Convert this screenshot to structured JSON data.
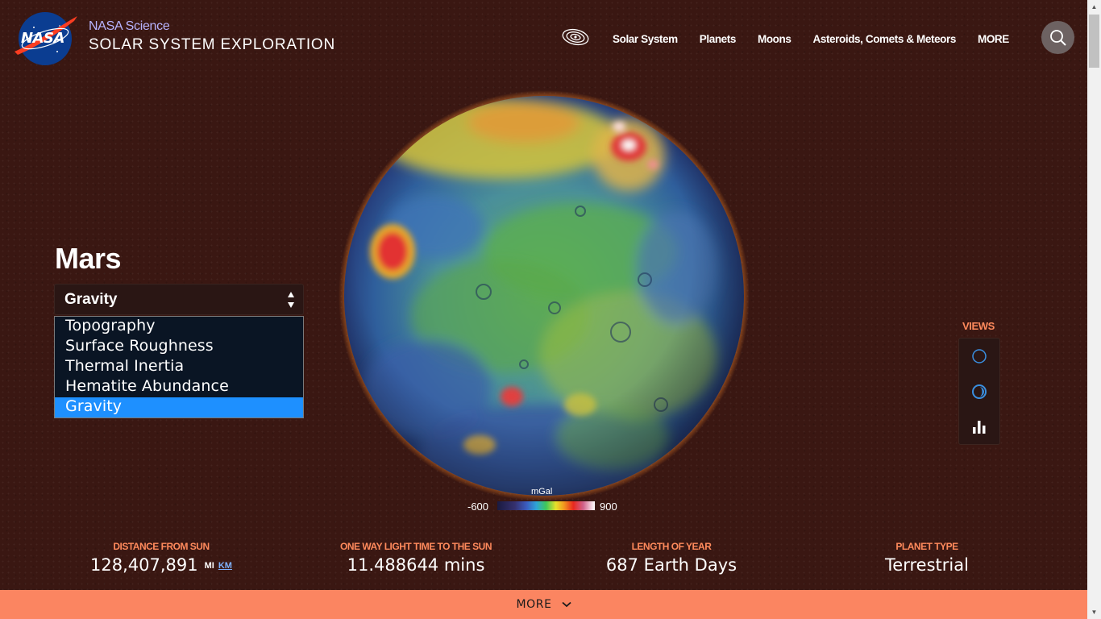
{
  "header": {
    "logo_text": "NASA",
    "brand_small": "NASA Science",
    "brand_big": "SOLAR SYSTEM EXPLORATION",
    "nav": [
      {
        "label": "Solar System"
      },
      {
        "label": "Planets"
      },
      {
        "label": "Moons"
      },
      {
        "label": "Asteroids, Comets & Meteors"
      },
      {
        "label": "MORE"
      }
    ],
    "search_icon": "search-icon",
    "orbit_icon": "solar-system-icon"
  },
  "planet": {
    "name": "Mars",
    "layer_select": {
      "value": "Gravity",
      "options": [
        "Topography",
        "Surface Roughness",
        "Thermal Inertia",
        "Hematite Abundance",
        "Gravity"
      ],
      "selected_index": 4
    }
  },
  "legend": {
    "unit": "mGal",
    "min": "-600",
    "max": "900"
  },
  "views": {
    "label": "VIEWS",
    "buttons": [
      {
        "icon": "globe-view-icon"
      },
      {
        "icon": "orbit-view-icon"
      },
      {
        "icon": "bar-chart-icon"
      }
    ]
  },
  "stats": [
    {
      "label": "DISTANCE FROM SUN",
      "value": "128,407,891",
      "units": [
        "MI",
        "KM"
      ]
    },
    {
      "label": "ONE WAY LIGHT TIME TO THE SUN",
      "value": "11.488644 mins"
    },
    {
      "label": "LENGTH OF YEAR",
      "value": "687 Earth Days"
    },
    {
      "label": "PLANET TYPE",
      "value": "Terrestrial"
    }
  ],
  "footer": {
    "more_label": "MORE"
  },
  "colors": {
    "background": "#3a1712",
    "accent": "#fb8561",
    "label_orange": "#ff8a5c",
    "selected_option": "#1e90ff"
  }
}
